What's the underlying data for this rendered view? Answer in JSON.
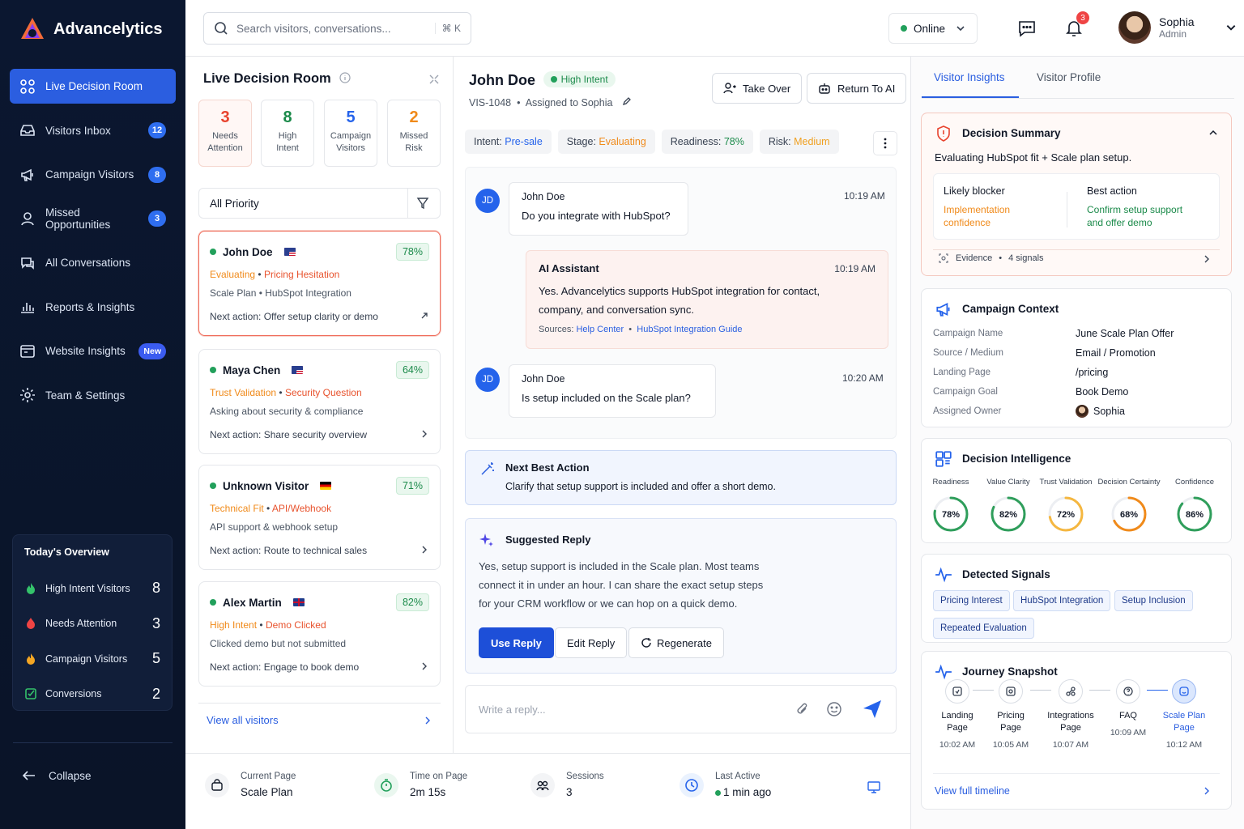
{
  "brand": {
    "name": "Advancelytics"
  },
  "sidebar": {
    "items": [
      {
        "label": "Live Decision Room",
        "icon": "grid-icon",
        "badge": ""
      },
      {
        "label": "Visitors Inbox",
        "icon": "inbox-icon",
        "badge": "12"
      },
      {
        "label": "Campaign Visitors",
        "icon": "megaphone-icon",
        "badge": "8"
      },
      {
        "label": "Missed Opportunities",
        "icon": "user-missed-icon",
        "badge": "3"
      },
      {
        "label": "All Conversations",
        "icon": "chat-icon",
        "badge": ""
      },
      {
        "label": "Reports & Insights",
        "icon": "bar-chart-icon",
        "badge": ""
      },
      {
        "label": "Website Insights",
        "icon": "browser-icon",
        "badge": "New"
      },
      {
        "label": "Team & Settings",
        "icon": "gear-icon",
        "badge": ""
      }
    ],
    "overview": {
      "title": "Today's Overview",
      "rows": [
        {
          "label": "High Intent Visitors",
          "value": "8",
          "color": "#34c26b"
        },
        {
          "label": "Needs Attention",
          "value": "3",
          "color": "#ef4444"
        },
        {
          "label": "Campaign Visitors",
          "value": "5",
          "color": "#f5a623"
        },
        {
          "label": "Conversions",
          "value": "2",
          "color": "#34c26b"
        }
      ]
    },
    "collapse_label": "Collapse"
  },
  "topbar": {
    "search_placeholder": "Search visitors, conversations...",
    "shortcut": "⌘ K",
    "status": "Online",
    "notifications": "3",
    "user_name": "Sophia",
    "user_role": "Admin"
  },
  "list": {
    "title": "Live Decision Room",
    "stats": [
      {
        "num": "3",
        "label1": "Needs",
        "label2": "Attention",
        "color": "#e8432e"
      },
      {
        "num": "8",
        "label1": "High",
        "label2": "Intent",
        "color": "#1b8a4a"
      },
      {
        "num": "5",
        "label1": "Campaign",
        "label2": "Visitors",
        "color": "#2563eb"
      },
      {
        "num": "2",
        "label1": "Missed",
        "label2": "Risk",
        "color": "#f08a1a"
      }
    ],
    "priority": "All Priority",
    "visitors": [
      {
        "name": "John Doe",
        "pct": "78%",
        "tag1": "Evaluating",
        "tag2": "Pricing Hesitation",
        "desc": "Scale Plan • HubSpot Integration",
        "next": "Next action: Offer setup clarity or demo"
      },
      {
        "name": "Maya Chen",
        "pct": "64%",
        "tag1": "Trust Validation",
        "tag2": "Security Question",
        "desc": "Asking about security & compliance",
        "next": "Next action: Share security overview"
      },
      {
        "name": "Unknown Visitor",
        "pct": "71%",
        "tag1": "Technical Fit",
        "tag2": "API/Webhook",
        "desc": "API support & webhook setup",
        "next": "Next action: Route to technical sales"
      },
      {
        "name": "Alex Martin",
        "pct": "82%",
        "tag1": "High Intent",
        "tag2": "Demo Clicked",
        "desc": "Clicked demo but not submitted",
        "next": "Next action: Engage to book demo"
      }
    ],
    "view_all": "View all visitors"
  },
  "conversation": {
    "name": "John Doe",
    "intent_pill": "High Intent",
    "visitor_id": "VIS-1048",
    "assigned": "Assigned to Sophia",
    "take_over": "Take Over",
    "return_ai": "Return To AI",
    "chips": [
      {
        "k": "Intent:",
        "v": "Pre-sale",
        "c": "#2563eb"
      },
      {
        "k": "Stage:",
        "v": "Evaluating",
        "c": "#f08a1a"
      },
      {
        "k": "Readiness:",
        "v": "78%",
        "c": "#1b8a4a"
      },
      {
        "k": "Risk:",
        "v": "Medium",
        "c": "#f0a020"
      }
    ],
    "messages": {
      "m1_avatar": "JD",
      "m1_who": "John Doe",
      "m1_text": "Do you integrate with HubSpot?",
      "m1_time": "10:19 AM",
      "ai_who": "AI Assistant",
      "ai_time": "10:19 AM",
      "ai_line1": "Yes. Advancelytics supports HubSpot integration for contact,",
      "ai_line2": "company, and conversation sync.",
      "sources_label": "Sources:",
      "source1": "Help Center",
      "source2": "HubSpot Integration Guide",
      "m2_avatar": "JD",
      "m2_who": "John Doe",
      "m2_text": "Is setup included on the Scale plan?",
      "m2_time": "10:20 AM"
    },
    "nba_title": "Next Best Action",
    "nba_text": "Clarify that setup support is included and offer a short demo.",
    "sugg_title": "Suggested Reply",
    "sugg_line1": "Yes, setup support is included in the Scale plan. Most teams",
    "sugg_line2": "connect it in under an hour. I can share the exact setup steps",
    "sugg_line3": "for your CRM workflow or we can hop on a quick demo.",
    "use_reply": "Use Reply",
    "edit_reply": "Edit Reply",
    "regenerate": "Regenerate",
    "reply_placeholder": "Write a reply..."
  },
  "bottom": {
    "current_page_k": "Current Page",
    "current_page_v": "Scale Plan",
    "time_k": "Time on Page",
    "time_v": "2m 15s",
    "sessions_k": "Sessions",
    "sessions_v": "3",
    "last_k": "Last Active",
    "last_v": "1 min ago"
  },
  "right": {
    "tab1": "Visitor Insights",
    "tab2": "Visitor Profile",
    "ds_title": "Decision Summary",
    "ds_text": "Evaluating HubSpot fit + Scale plan setup.",
    "blocker_k": "Likely blocker",
    "blocker_v1": "Implementation",
    "blocker_v2": "confidence",
    "best_k": "Best action",
    "best_v1": "Confirm setup support",
    "best_v2": "and offer demo",
    "evidence": "Evidence",
    "signals_count": "4 signals",
    "cc_title": "Campaign Context",
    "cc": [
      {
        "k": "Campaign Name",
        "v": "June Scale Plan Offer"
      },
      {
        "k": "Source / Medium",
        "v": "Email / Promotion"
      },
      {
        "k": "Landing Page",
        "v": "/pricing"
      },
      {
        "k": "Campaign Goal",
        "v": "Book Demo"
      },
      {
        "k": "Assigned Owner",
        "v": "Sophia"
      }
    ],
    "di_title": "Decision Intelligence",
    "di": [
      {
        "label": "Readiness",
        "value": 78,
        "text": "78%",
        "color": "#2f9e5b"
      },
      {
        "label": "Value Clarity",
        "value": 82,
        "text": "82%",
        "color": "#2f9e5b"
      },
      {
        "label": "Trust Validation",
        "value": 72,
        "text": "72%",
        "color": "#f5b740"
      },
      {
        "label": "Decision Certainty",
        "value": 68,
        "text": "68%",
        "color": "#f08a1a"
      },
      {
        "label": "Confidence",
        "value": 86,
        "text": "86%",
        "color": "#2f9e5b"
      }
    ],
    "sig_title": "Detected Signals",
    "signals": [
      "Pricing Interest",
      "HubSpot Integration",
      "Setup Inclusion",
      "Repeated Evaluation"
    ],
    "js_title": "Journey Snapshot",
    "journey": [
      {
        "l1": "Landing",
        "l2": "Page",
        "t": "10:02 AM"
      },
      {
        "l1": "Pricing",
        "l2": "Page",
        "t": "10:05 AM"
      },
      {
        "l1": "Integrations",
        "l2": "Page",
        "t": "10:07 AM"
      },
      {
        "l1": "FAQ",
        "l2": "",
        "t": "10:09 AM"
      },
      {
        "l1": "Scale Plan",
        "l2": "Page",
        "t": "10:12 AM"
      }
    ],
    "timeline_link": "View full timeline"
  }
}
